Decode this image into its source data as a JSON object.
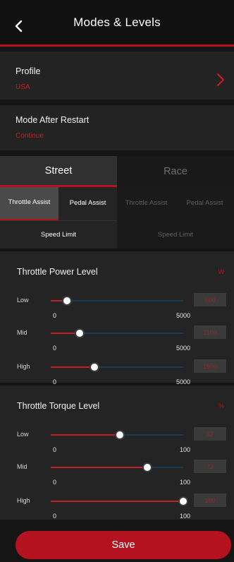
{
  "header": {
    "title": "Modes & Levels"
  },
  "profile": {
    "label": "Profile",
    "value": "USA"
  },
  "restart": {
    "label": "Mode After Restart",
    "value": "Continue"
  },
  "modes": {
    "street": "Street",
    "race": "Race"
  },
  "submodes": {
    "street": {
      "throttle": "Throttle Assist",
      "pedal": "Pedal Assist",
      "speed": "Speed Limit"
    },
    "race": {
      "throttle": "Throttle Assist",
      "pedal": "Pedal Assist",
      "speed": "Speed Limit"
    }
  },
  "power": {
    "title": "Throttle Power Level",
    "unit": "W",
    "sliders": [
      {
        "label": "Low",
        "fraction": 0.12,
        "value": "600",
        "min": "0",
        "max": "5000"
      },
      {
        "label": "Mid",
        "fraction": 0.22,
        "value": "1100",
        "min": "0",
        "max": "5000"
      },
      {
        "label": "High",
        "fraction": 0.33,
        "value": "1650",
        "min": "0",
        "max": "5000"
      }
    ]
  },
  "torque": {
    "title": "Throttle Torque Level",
    "unit": "%",
    "sliders": [
      {
        "label": "Low",
        "fraction": 0.52,
        "value": "52",
        "min": "0",
        "max": "100"
      },
      {
        "label": "Mid",
        "fraction": 0.73,
        "value": "73",
        "min": "0",
        "max": "100"
      },
      {
        "label": "High",
        "fraction": 1.0,
        "value": "100",
        "min": "0",
        "max": "100"
      }
    ]
  },
  "save_label": "Save"
}
